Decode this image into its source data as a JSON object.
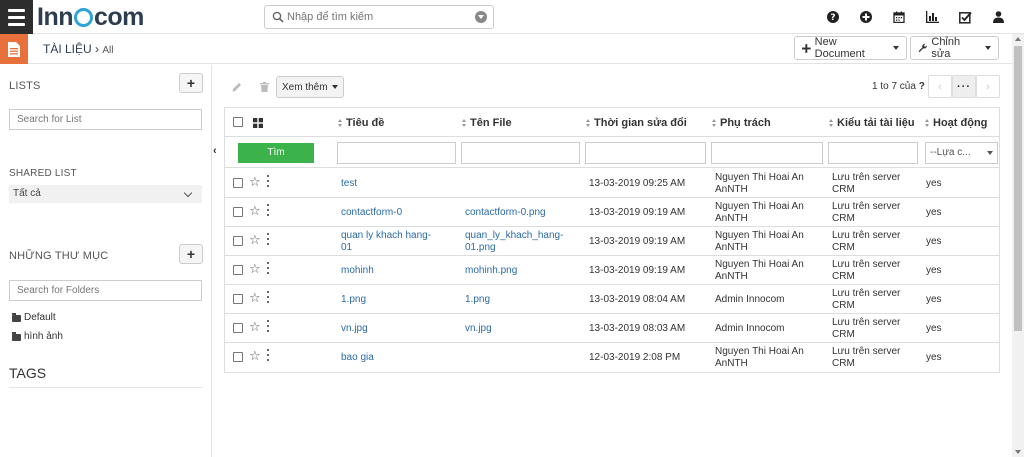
{
  "app": {
    "logo_pre": "Inn",
    "logo_post": "com"
  },
  "search": {
    "placeholder": "Nhập để tìm kiếm"
  },
  "top_icons": [
    "question-circle-icon",
    "plus-circle-icon",
    "calendar-icon",
    "bar-chart-icon",
    "checkbox-icon",
    "user-icon"
  ],
  "breadcrumb": {
    "title": "TÀI LIỆU",
    "sep": " › ",
    "sub": "All"
  },
  "actions": {
    "new_document": "New Document",
    "edit": "Chỉnh sửa"
  },
  "sidebar": {
    "lists_title": "LISTS",
    "lists_search_placeholder": "Search for List",
    "shared_title": "SHARED LIST",
    "shared_value": "Tất cả",
    "folders_title": "NHỮNG THƯ MỤC",
    "folders_search_placeholder": "Search for Folders",
    "folders": [
      "Default",
      "hình ảnh"
    ],
    "tags_title": "TAGS"
  },
  "toolbar": {
    "more_label": "Xem thêm",
    "pagination": "1 to 7  của",
    "pagination_q": "?",
    "more_pages": "···"
  },
  "table": {
    "headers": [
      "Tiêu đề",
      "Tên File",
      "Thời gian sửa đổi",
      "Phụ trách",
      "Kiểu tải tài liệu",
      "Hoạt động"
    ],
    "filter_button": "Tìm",
    "filter_select": "--Lựa c...",
    "rows": [
      {
        "title": [
          "test"
        ],
        "file": [],
        "time": "13-03-2019 09:25 AM",
        "owner": [
          "Nguyen Thi Hoai An",
          "AnNTH"
        ],
        "type": [
          "Lưu trên server",
          "CRM"
        ],
        "active": "yes"
      },
      {
        "title": [
          "contactform-0"
        ],
        "file": [
          "contactform-0.png"
        ],
        "time": "13-03-2019 09:19 AM",
        "owner": [
          "Nguyen Thi Hoai An",
          "AnNTH"
        ],
        "type": [
          "Lưu trên server",
          "CRM"
        ],
        "active": "yes"
      },
      {
        "title": [
          "quan ly khach hang-",
          "01"
        ],
        "file": [
          "quan_ly_khach_hang-",
          "01.png"
        ],
        "time": "13-03-2019 09:19 AM",
        "owner": [
          "Nguyen Thi Hoai An",
          "AnNTH"
        ],
        "type": [
          "Lưu trên server",
          "CRM"
        ],
        "active": "yes"
      },
      {
        "title": [
          "mohinh"
        ],
        "file": [
          "mohinh.png"
        ],
        "time": "13-03-2019 09:19 AM",
        "owner": [
          "Nguyen Thi Hoai An",
          "AnNTH"
        ],
        "type": [
          "Lưu trên server",
          "CRM"
        ],
        "active": "yes"
      },
      {
        "title": [
          "1.png"
        ],
        "file": [
          "1.png"
        ],
        "time": "13-03-2019 08:04 AM",
        "owner": [
          "Admin Innocom"
        ],
        "type": [
          "Lưu trên server",
          "CRM"
        ],
        "active": "yes"
      },
      {
        "title": [
          "vn.jpg"
        ],
        "file": [
          "vn.jpg"
        ],
        "time": "13-03-2019 08:03 AM",
        "owner": [
          "Admin Innocom"
        ],
        "type": [
          "Lưu trên server",
          "CRM"
        ],
        "active": "yes"
      },
      {
        "title": [
          "bao gia"
        ],
        "file": [],
        "time": "12-03-2019 2:08 PM",
        "owner": [
          "Nguyen Thi Hoai An",
          "AnNTH"
        ],
        "type": [
          "Lưu trên server",
          "CRM"
        ],
        "active": "yes"
      }
    ]
  },
  "colors": {
    "accent_orange": "#e8703a",
    "logo_dark": "#2d3e50",
    "logo_ring": "#2fa4d8",
    "search_green": "#3cb34a",
    "link_blue": "#2a6aa8"
  }
}
